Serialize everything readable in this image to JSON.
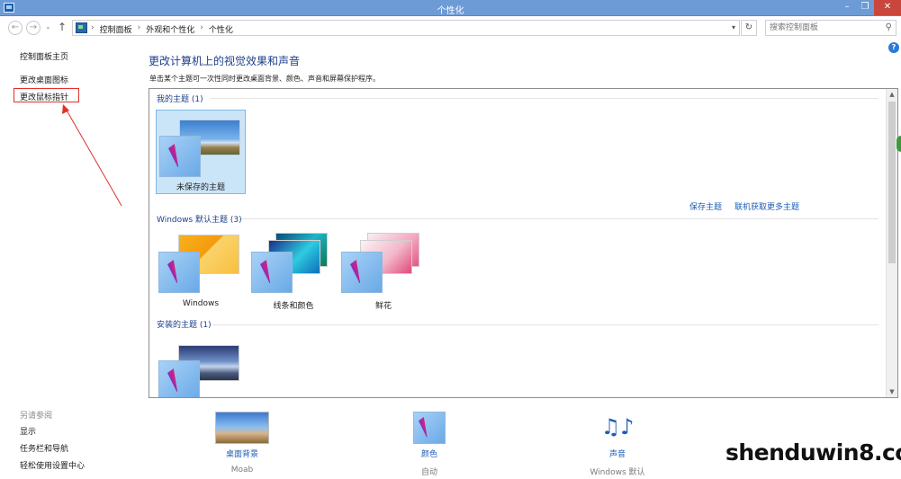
{
  "window": {
    "title": "个性化"
  },
  "nav": {
    "breadcrumbs": [
      "控制面板",
      "外观和个性化",
      "个性化"
    ],
    "search_placeholder": "搜索控制面板"
  },
  "left_pane": {
    "links": [
      "控制面板主页",
      "更改桌面图标",
      "更改鼠标指针"
    ],
    "see_also_heading": "另请参阅",
    "see_also_links": [
      "显示",
      "任务栏和导航",
      "轻松使用设置中心"
    ]
  },
  "main": {
    "heading": "更改计算机上的视觉效果和声音",
    "description": "单击某个主题可一次性同时更改桌面背景、颜色、声音和屏幕保护程序。",
    "my_themes": {
      "heading": "我的主题 (1)",
      "items": [
        {
          "label": "未保存的主题",
          "selected": true
        }
      ],
      "save_link": "保存主题",
      "online_link": "联机获取更多主题"
    },
    "windows_themes": {
      "heading": "Windows 默认主题 (3)",
      "items": [
        {
          "label": "Windows"
        },
        {
          "label": "线条和颜色"
        },
        {
          "label": "鲜花"
        }
      ]
    },
    "installed_themes": {
      "heading": "安装的主题 (1)"
    }
  },
  "bottom_bar": {
    "desktop_background": {
      "label": "桌面背景",
      "value": "Moab"
    },
    "color": {
      "label": "颜色",
      "value": "自动"
    },
    "sounds": {
      "label": "声音",
      "value": "Windows 默认"
    }
  },
  "watermark": "shenduwin8.com",
  "colors": {
    "title_bar": "#6d9bd6",
    "link": "#1e5db6",
    "heading": "#1e3f8c",
    "highlight": "#e0312b",
    "selected_tile": "#cbe5f8"
  }
}
